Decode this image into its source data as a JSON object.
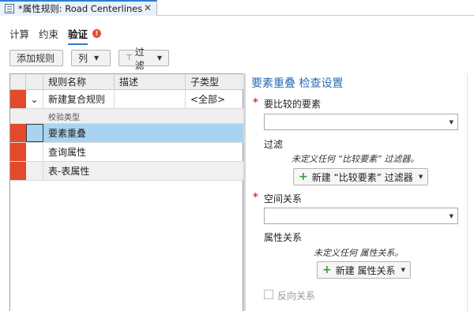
{
  "window": {
    "title": "*属性规则: Road Centerlines",
    "close_glyph": "✕"
  },
  "subtabs": [
    {
      "label": "计算"
    },
    {
      "label": "约束"
    },
    {
      "label": "验证"
    }
  ],
  "warning_glyph": "!",
  "toolbar": {
    "add_rule_label": "添加规则",
    "columns_label": "列",
    "filter_label": "过滤",
    "dropdown_glyph": "▼",
    "filter_glyph": "⊤"
  },
  "grid": {
    "columns": [
      "规则名称",
      "描述",
      "子类型"
    ],
    "new_row": {
      "expand_glyph": "⌄",
      "name": "新建复合规则",
      "description": "",
      "subtype": "<全部>"
    },
    "group_label": "校验类型",
    "rows": [
      {
        "name": "要素重叠"
      },
      {
        "name": "查询属性"
      },
      {
        "name": "表-表属性"
      }
    ]
  },
  "panel": {
    "title": "要素重叠  检查设置",
    "compare_features_label": "要比较的要素",
    "filter_label": "过滤",
    "filter_note": "未定义任何 “比较要素” 过滤器。",
    "new_filter_button": "新建 “比较要素” 过滤器",
    "spatial_relation_label": "空间关系",
    "attribute_relation_label": "属性关系",
    "attribute_note": "未定义任何 属性关系。",
    "new_attribute_button": "新建  属性关系",
    "reverse_relation_label": "反向关系",
    "required_glyph": "*",
    "plus_glyph": "+",
    "dropdown_glyph": "▼"
  },
  "colors": {
    "accent": "#2b7cd3",
    "error_marker": "#e4492b",
    "selected_row": "#a9d4f1",
    "title_blue": "#2b6cb8",
    "add_green": "#3d9a3d"
  }
}
